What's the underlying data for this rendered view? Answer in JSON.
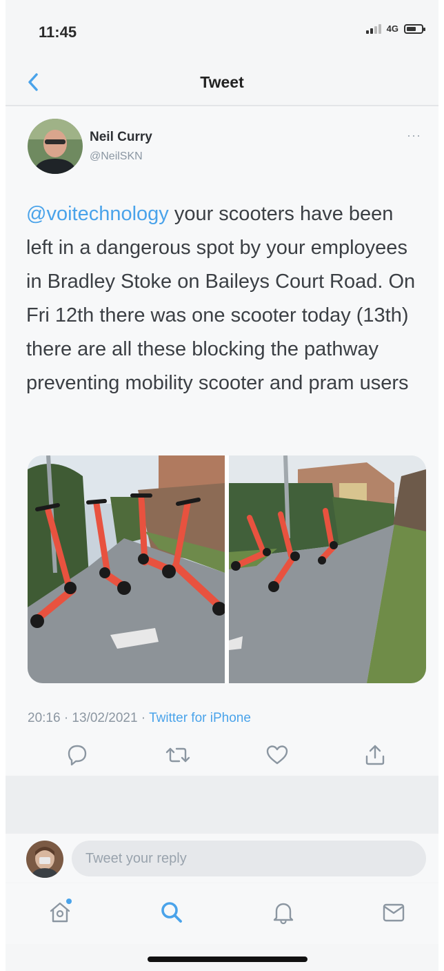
{
  "status_bar": {
    "time": "11:45",
    "network": "4G"
  },
  "header": {
    "title": "Tweet",
    "back_icon": "chevron-left-icon"
  },
  "tweet": {
    "author_name": "Neil Curry",
    "author_handle": "@NeilSKN",
    "mention": "@voitechnology",
    "text": " your scooters have been left in a dangerous spot by your employees in Bradley Stoke on Baileys Court Road. On Fri 12th there was one scooter today (13th) there are all these blocking the pathway preventing mobility scooter and pram users",
    "timestamp": "20:16 · 13/02/2021 · ",
    "client": "Twitter for iPhone",
    "photos": [
      {
        "subject": "orange-e-scooters-on-footpath"
      },
      {
        "subject": "orange-e-scooters-on-footpath"
      }
    ],
    "actions": [
      "reply-icon",
      "retweet-icon",
      "like-icon",
      "share-icon"
    ]
  },
  "reply": {
    "placeholder": "Tweet your reply"
  },
  "tab_bar": {
    "items": [
      "home-icon",
      "search-icon",
      "notifications-icon",
      "messages-icon"
    ],
    "active": "search-icon"
  },
  "colors": {
    "accent": "#4aa3ea",
    "scooter": "#e8523f",
    "background": "#f5f6f7"
  }
}
